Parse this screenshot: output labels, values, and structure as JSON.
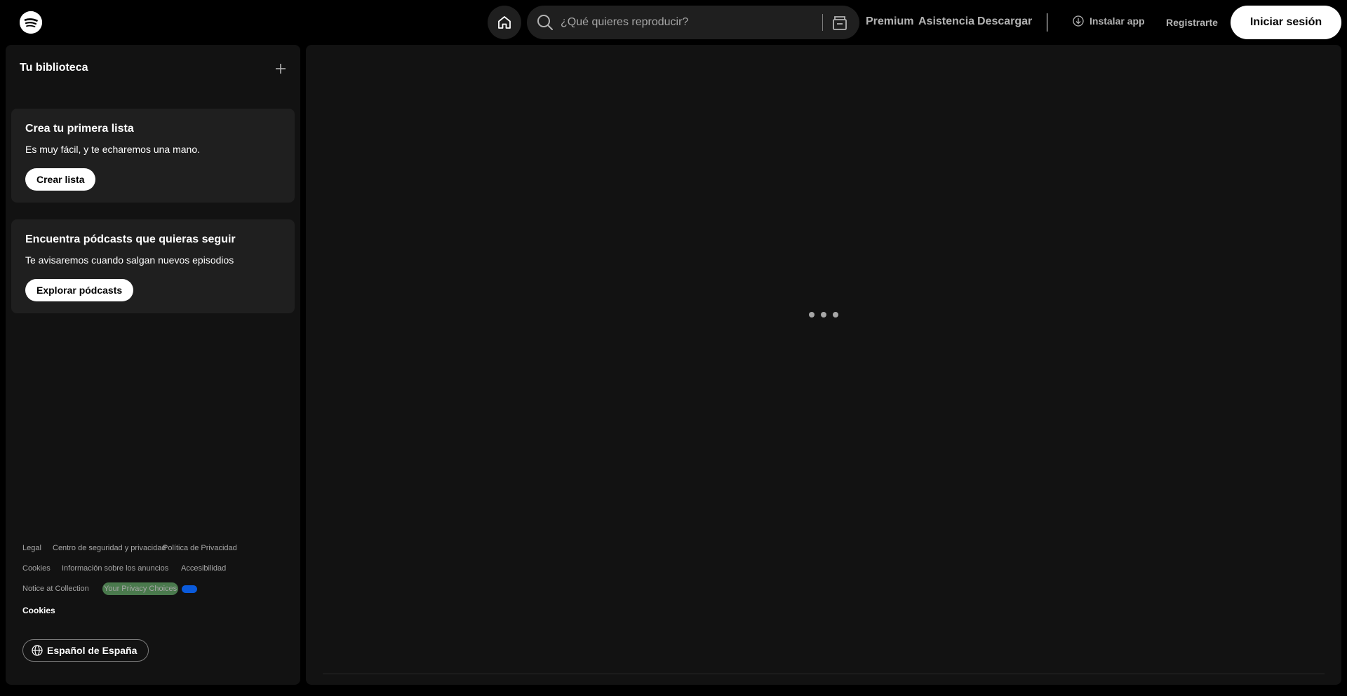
{
  "topbar": {
    "search_placeholder": "¿Qué quieres reproducir?",
    "nav": {
      "premium": "Premium",
      "support": "Asistencia",
      "download": "Descargar"
    },
    "install_app": "Instalar app",
    "register": "Registrarte",
    "login": "Iniciar sesión"
  },
  "sidebar": {
    "title": "Tu biblioteca",
    "cards": [
      {
        "title": "Crea tu primera lista",
        "description": "Es muy fácil, y te echaremos una mano.",
        "button": "Crear lista"
      },
      {
        "title": "Encuentra pódcasts que quieras seguir",
        "description": "Te avisaremos cuando salgan nuevos episodios",
        "button": "Explorar pódcasts"
      }
    ],
    "footer": {
      "legal": "Legal",
      "safety": "Centro de seguridad y privacidad",
      "privacy_policy": "Política de Privacidad",
      "cookies": "Cookies",
      "ads_info": "Información sobre los anuncios",
      "accessibility": "Accesibilidad",
      "notice": "Notice at Collection",
      "privacy_choices": "Your Privacy Choices",
      "cookies_link": "Cookies"
    },
    "language": "Español de España"
  },
  "colors": {
    "background": "#000000",
    "panel": "#121212",
    "card": "#1f1f1f",
    "muted_text": "#b3b3b3"
  }
}
